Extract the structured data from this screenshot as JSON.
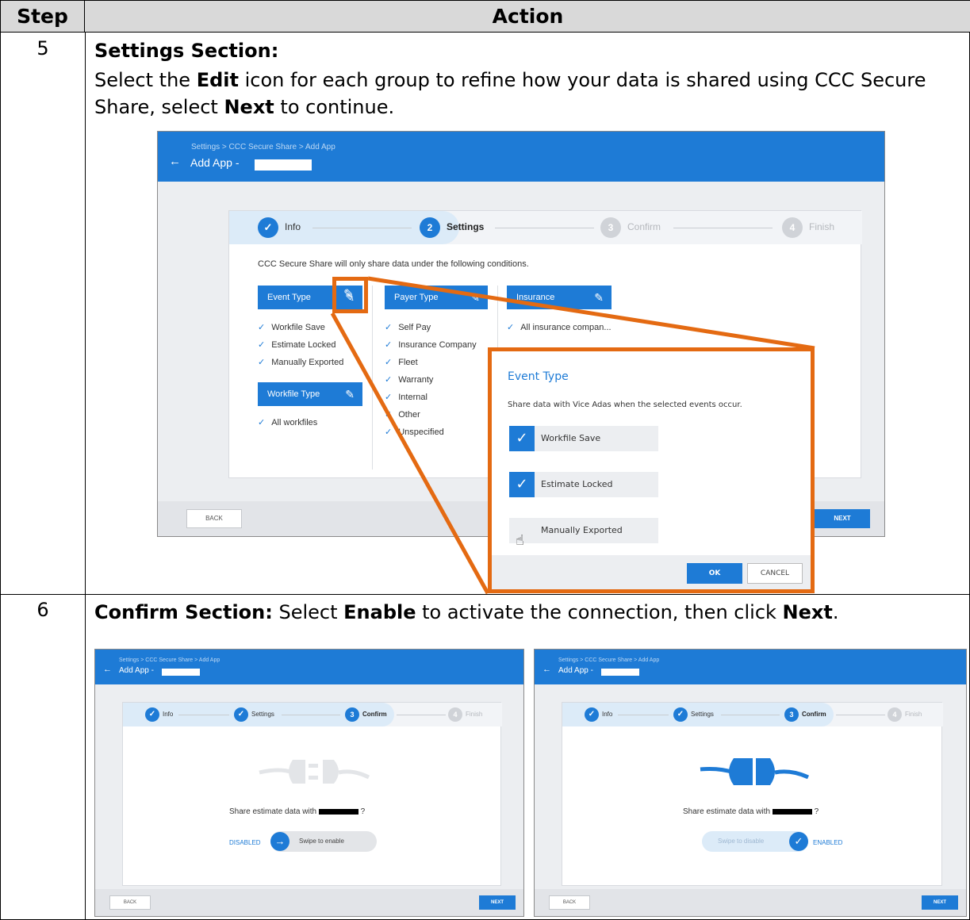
{
  "table": {
    "header_step": "Step",
    "header_action": "Action"
  },
  "step5": {
    "number": "5",
    "title": "Settings Section:",
    "line1_a": "Select the ",
    "line1_b": "Edit",
    "line1_c": " icon for each group to refine how your data is shared using CCC Secure",
    "line2_a": "Share, select ",
    "line2_b": "Next",
    "line2_c": " to continue.",
    "screen": {
      "breadcrumb": "Settings > CCC Secure Share > Add App",
      "title": "Add App -",
      "steps": [
        {
          "num": "",
          "label": "Info"
        },
        {
          "num": "2",
          "label": "Settings"
        },
        {
          "num": "3",
          "label": "Confirm"
        },
        {
          "num": "4",
          "label": "Finish"
        }
      ],
      "intro": "CCC Secure Share will only share data under the following conditions.",
      "event_type": {
        "title": "Event Type",
        "items": [
          "Workfile Save",
          "Estimate Locked",
          "Manually Exported"
        ]
      },
      "workfile_type": {
        "title": "Workfile Type",
        "items": [
          "All workfiles"
        ]
      },
      "payer_type": {
        "title": "Payer Type",
        "items": [
          "Self Pay",
          "Insurance Company",
          "Fleet",
          "Warranty",
          "Internal",
          "Other",
          "Unspecified"
        ]
      },
      "insurance": {
        "title": "Insurance",
        "items": [
          "All insurance compan..."
        ]
      },
      "back": "BACK",
      "next": "NEXT"
    },
    "modal": {
      "title": "Event Type",
      "description": "Share data with Vice Adas when the selected events occur.",
      "options": [
        "Workfile Save",
        "Estimate Locked",
        "Manually Exported"
      ],
      "ok": "OK",
      "cancel": "CANCEL"
    }
  },
  "step6": {
    "number": "6",
    "title": "Confirm Section:",
    "text_a": " Select ",
    "text_b": "Enable",
    "text_c": " to activate the connection, then click ",
    "text_d": "Next",
    "text_e": ".",
    "left": {
      "breadcrumb": "Settings > CCC Secure Share > Add App",
      "title": "Add App -",
      "steps": [
        "Info",
        "Settings",
        "Confirm",
        "Finish"
      ],
      "step_nums": [
        "3",
        "4"
      ],
      "question_a": "Share estimate data with",
      "question_b": "?",
      "status": "DISABLED",
      "swipe": "Swipe to enable",
      "back": "BACK",
      "next": "NEXT"
    },
    "right": {
      "breadcrumb": "Settings > CCC Secure Share > Add App",
      "title": "Add App -",
      "steps": [
        "Info",
        "Settings",
        "Confirm",
        "Finish"
      ],
      "step_nums": [
        "3",
        "4"
      ],
      "question_a": "Share estimate data with",
      "question_b": "?",
      "swipe": "Swipe to disable",
      "status": "ENABLED",
      "back": "BACK",
      "next": "NEXT"
    }
  },
  "colors": {
    "accent": "#1e7bd6",
    "highlight": "#e46a12"
  }
}
